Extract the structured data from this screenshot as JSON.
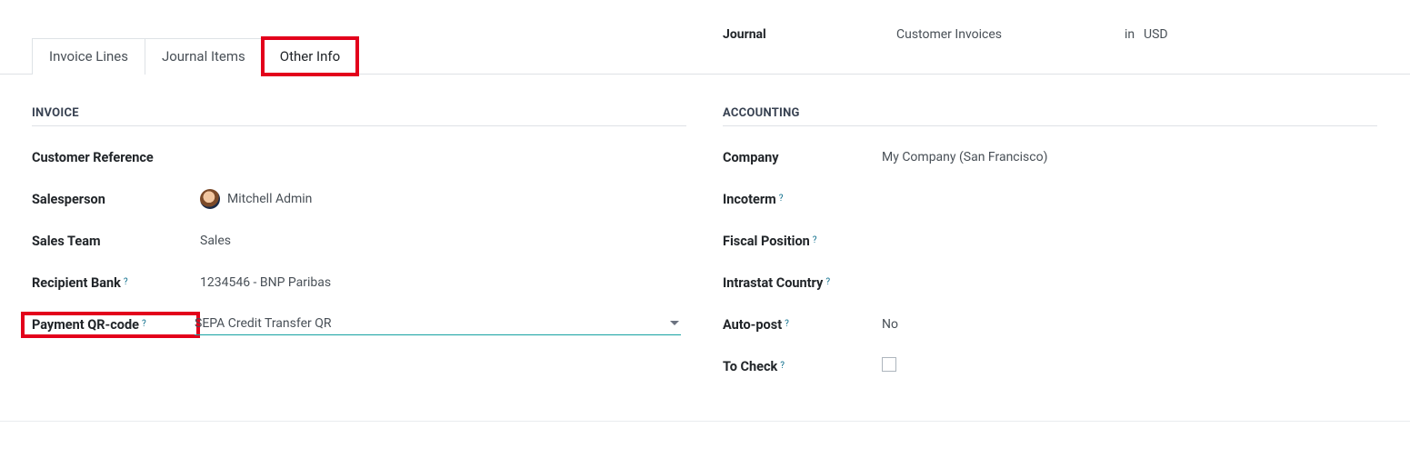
{
  "header_cutoff": {
    "label": "Journal",
    "value": "Customer Invoices",
    "in": "in",
    "currency": "USD"
  },
  "tabs": {
    "invoice_lines": "Invoice Lines",
    "journal_items": "Journal Items",
    "other_info": "Other Info"
  },
  "sections": {
    "invoice_title": "INVOICE",
    "accounting_title": "ACCOUNTING"
  },
  "invoice": {
    "customer_reference_label": "Customer Reference",
    "customer_reference_value": "",
    "salesperson_label": "Salesperson",
    "salesperson_value": "Mitchell Admin",
    "sales_team_label": "Sales Team",
    "sales_team_value": "Sales",
    "recipient_bank_label": "Recipient Bank",
    "recipient_bank_value": "1234546 - BNP Paribas",
    "payment_qr_label": "Payment QR-code",
    "payment_qr_value": "SEPA Credit Transfer QR"
  },
  "accounting": {
    "company_label": "Company",
    "company_value": "My Company (San Francisco)",
    "incoterm_label": "Incoterm",
    "incoterm_value": "",
    "fiscal_position_label": "Fiscal Position",
    "fiscal_position_value": "",
    "intrastat_country_label": "Intrastat Country",
    "intrastat_country_value": "",
    "auto_post_label": "Auto-post",
    "auto_post_value": "No",
    "to_check_label": "To Check",
    "to_check_checked": false
  },
  "help_mark": "?"
}
